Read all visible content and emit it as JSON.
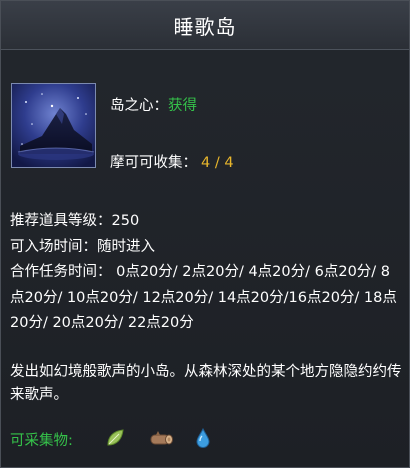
{
  "window": {
    "title": "睡歌岛"
  },
  "island": {
    "heart_label": "岛之心：",
    "heart_status": "获得",
    "mokoko_label": "摩可可收集：",
    "mokoko_count": "4 / 4",
    "thumbnail_icon": "island-thumbnail"
  },
  "details": {
    "item_level": "推荐道具等级：250",
    "entry_time": "可入场时间：随时进入",
    "coop_times": "合作任务时间： 0点20分/ 2点20分/ 4点20分/ 6点20分/ 8点20分/ 10点20分/ 12点20分/ 14点20分/16点20分/ 18点20分/ 20点20分/ 22点20分"
  },
  "description": "发出如幻境般歌声的小岛。从森林深处的某个地方隐隐约约传来歌声。",
  "collectibles": {
    "label": "可采集物:",
    "icons": [
      "leaf-icon",
      "log-icon",
      "water-drop-icon"
    ]
  },
  "colors": {
    "status_green": "#35c24a",
    "count_yellow": "#e8b62c"
  }
}
